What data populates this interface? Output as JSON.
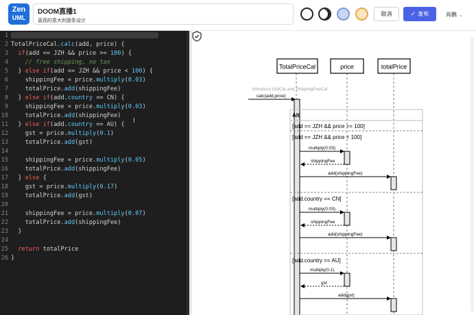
{
  "header": {
    "logo_line1": "Zen",
    "logo_line2": "UML",
    "title": "DOOM直播1",
    "subtitle": "直观的意大利面条设计",
    "cancel_label": "取消",
    "publish_label": "发布",
    "publish_icon": "check-icon",
    "user_name": "肖鹏",
    "themes": [
      "#ffffff",
      "#222222",
      "#c9d6f3",
      "#fbe4c2"
    ],
    "accent": "#4a63e6"
  },
  "editor": {
    "lines": [
      {
        "n": "1",
        "t": [
          {
            "c": "",
            "v": ""
          }
        ]
      },
      {
        "n": "2",
        "t": [
          {
            "c": "",
            "v": "TotalPriceCal."
          },
          {
            "c": "n",
            "v": "calc"
          },
          {
            "c": "",
            "v": "(add, price) {"
          }
        ]
      },
      {
        "n": "3",
        "t": [
          {
            "c": "",
            "v": "  "
          },
          {
            "c": "k",
            "v": "if"
          },
          {
            "c": "",
            "v": "(add == JZH && price >= "
          },
          {
            "c": "n",
            "v": "100"
          },
          {
            "c": "",
            "v": ") {"
          }
        ]
      },
      {
        "n": "4",
        "t": [
          {
            "c": "c",
            "v": "    // free shipping, no tax"
          }
        ]
      },
      {
        "n": "5",
        "t": [
          {
            "c": "",
            "v": "  } "
          },
          {
            "c": "k",
            "v": "else if"
          },
          {
            "c": "",
            "v": "(add == JZH && price < "
          },
          {
            "c": "n",
            "v": "100"
          },
          {
            "c": "",
            "v": ") {"
          }
        ]
      },
      {
        "n": "6",
        "t": [
          {
            "c": "",
            "v": "    shippingFee = price."
          },
          {
            "c": "n",
            "v": "multiply"
          },
          {
            "c": "",
            "v": "("
          },
          {
            "c": "n",
            "v": "0.03"
          },
          {
            "c": "",
            "v": ")"
          }
        ]
      },
      {
        "n": "7",
        "t": [
          {
            "c": "",
            "v": "    totalPrice."
          },
          {
            "c": "n",
            "v": "add"
          },
          {
            "c": "",
            "v": "(shippingFee)"
          }
        ]
      },
      {
        "n": "8",
        "t": [
          {
            "c": "",
            "v": "  } "
          },
          {
            "c": "k",
            "v": "else if"
          },
          {
            "c": "",
            "v": "(add."
          },
          {
            "c": "n",
            "v": "country"
          },
          {
            "c": "",
            "v": " == CN) {"
          }
        ]
      },
      {
        "n": "9",
        "t": [
          {
            "c": "",
            "v": "    shippingFee = price."
          },
          {
            "c": "n",
            "v": "multiply"
          },
          {
            "c": "",
            "v": "("
          },
          {
            "c": "n",
            "v": "0.03"
          },
          {
            "c": "",
            "v": ")"
          }
        ]
      },
      {
        "n": "10",
        "t": [
          {
            "c": "",
            "v": "    totalPrice."
          },
          {
            "c": "n",
            "v": "add"
          },
          {
            "c": "",
            "v": "(shippingFee)"
          }
        ]
      },
      {
        "n": "11",
        "t": [
          {
            "c": "",
            "v": "  } "
          },
          {
            "c": "k",
            "v": "else if"
          },
          {
            "c": "",
            "v": "(add."
          },
          {
            "c": "n",
            "v": "country"
          },
          {
            "c": "",
            "v": " == AU) {"
          }
        ]
      },
      {
        "n": "12",
        "t": [
          {
            "c": "",
            "v": "    gst = price."
          },
          {
            "c": "n",
            "v": "multiply"
          },
          {
            "c": "",
            "v": "("
          },
          {
            "c": "n",
            "v": "0.1"
          },
          {
            "c": "",
            "v": ")"
          }
        ]
      },
      {
        "n": "13",
        "t": [
          {
            "c": "",
            "v": "    totalPrice."
          },
          {
            "c": "n",
            "v": "add"
          },
          {
            "c": "",
            "v": "(gst)"
          }
        ]
      },
      {
        "n": "14",
        "t": [
          {
            "c": "",
            "v": ""
          }
        ]
      },
      {
        "n": "15",
        "t": [
          {
            "c": "",
            "v": "    shippingFee = price."
          },
          {
            "c": "n",
            "v": "multiply"
          },
          {
            "c": "",
            "v": "("
          },
          {
            "c": "n",
            "v": "0.05"
          },
          {
            "c": "",
            "v": ")"
          }
        ]
      },
      {
        "n": "16",
        "t": [
          {
            "c": "",
            "v": "    totalPrice."
          },
          {
            "c": "n",
            "v": "add"
          },
          {
            "c": "",
            "v": "(shippingFee)"
          }
        ]
      },
      {
        "n": "17",
        "t": [
          {
            "c": "",
            "v": "  } "
          },
          {
            "c": "k",
            "v": "else"
          },
          {
            "c": "",
            "v": " {"
          }
        ]
      },
      {
        "n": "18",
        "t": [
          {
            "c": "",
            "v": "    gst = price."
          },
          {
            "c": "n",
            "v": "multiply"
          },
          {
            "c": "",
            "v": "("
          },
          {
            "c": "n",
            "v": "0.17"
          },
          {
            "c": "",
            "v": ")"
          }
        ]
      },
      {
        "n": "19",
        "t": [
          {
            "c": "",
            "v": "    totalPrice."
          },
          {
            "c": "n",
            "v": "add"
          },
          {
            "c": "",
            "v": "(gst)"
          }
        ]
      },
      {
        "n": "20",
        "t": [
          {
            "c": "",
            "v": ""
          }
        ]
      },
      {
        "n": "21",
        "t": [
          {
            "c": "",
            "v": "    shippingFee = price."
          },
          {
            "c": "n",
            "v": "multiply"
          },
          {
            "c": "",
            "v": "("
          },
          {
            "c": "n",
            "v": "0.07"
          },
          {
            "c": "",
            "v": ")"
          }
        ]
      },
      {
        "n": "22",
        "t": [
          {
            "c": "",
            "v": "    totalPrice."
          },
          {
            "c": "n",
            "v": "add"
          },
          {
            "c": "",
            "v": "(shippingFee)"
          }
        ]
      },
      {
        "n": "23",
        "t": [
          {
            "c": "",
            "v": "  }"
          }
        ]
      },
      {
        "n": "24",
        "t": [
          {
            "c": "",
            "v": ""
          }
        ]
      },
      {
        "n": "25",
        "t": [
          {
            "c": "",
            "v": "  "
          },
          {
            "c": "k",
            "v": "return"
          },
          {
            "c": "",
            "v": " totalPrice"
          }
        ]
      },
      {
        "n": "26",
        "t": [
          {
            "c": "",
            "v": "}"
          }
        ]
      }
    ],
    "cursor_glyph": "I"
  },
  "diagram": {
    "participants": [
      "TotalPriceCal",
      "price",
      "totalPrice"
    ],
    "note": "Introduce GstCal and ShippingFeeCal",
    "entry_message": "calc(add,price)",
    "alt_label": "Alt",
    "sections": [
      {
        "guard": "[add == JZH && price >= 100]",
        "messages": []
      },
      {
        "guard": "[add == JZH && price < 100]",
        "messages": [
          "multiply(0.03)",
          "shippingFee",
          "add(shippingFee)"
        ]
      },
      {
        "guard": "[add.country == CN]",
        "messages": [
          "multiply(0.03)",
          "shippingFee",
          "add(shippingFee)"
        ]
      },
      {
        "guard": "[add.country == AU]",
        "messages": [
          "multiply(0.1)",
          "gst",
          "add(gst)"
        ]
      }
    ],
    "shield_icon": "shield-check-icon"
  }
}
